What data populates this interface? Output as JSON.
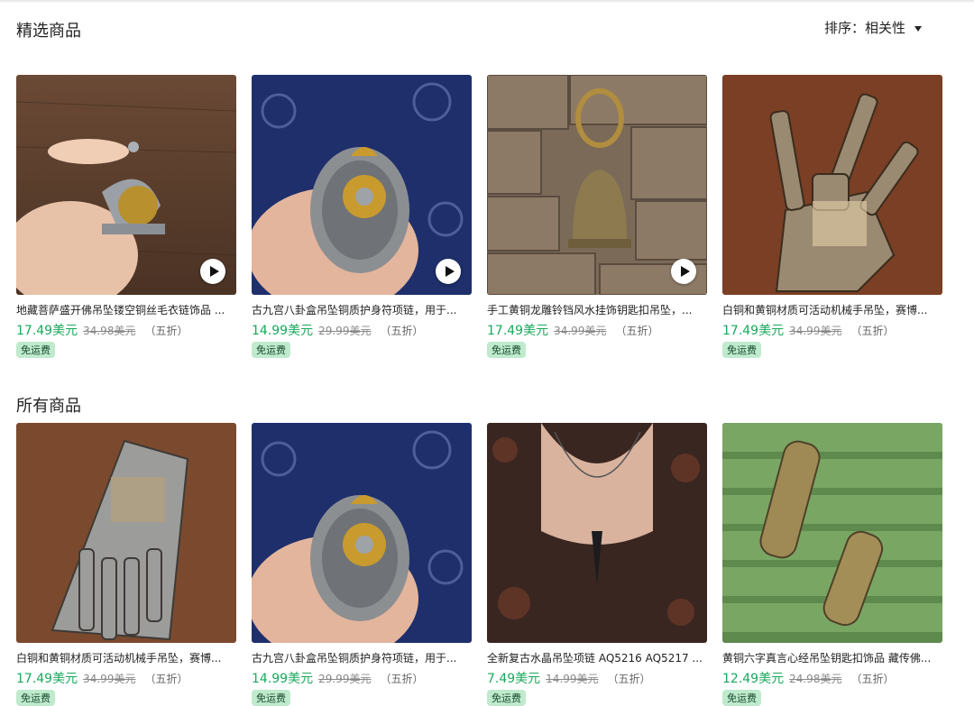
{
  "featured": {
    "title": "精选商品",
    "sort_label": "排序：相关性",
    "products": [
      {
        "title": "地藏菩萨盛开佛吊坠镂空铜丝毛衣链饰品 ...",
        "price": "17.49美元",
        "original_price": "34.98美元",
        "discount": "（五折）",
        "badge": "免运费",
        "icon": "play-icon"
      },
      {
        "title": "古九宫八卦盒吊坠铜质护身符项链，用于...",
        "price": "14.99美元",
        "original_price": "29.99美元",
        "discount": "（五折）",
        "badge": "免运费",
        "icon": "play-icon"
      },
      {
        "title": "手工黄铜龙雕铃铛风水挂饰钥匙扣吊坠，...",
        "price": "17.49美元",
        "original_price": "34.99美元",
        "discount": "（五折）",
        "badge": "免运费",
        "icon": "play-icon"
      },
      {
        "title": "白铜和黄铜材质可活动机械手吊坠，赛博...",
        "price": "17.49美元",
        "original_price": "34.99美元",
        "discount": "（五折）",
        "badge": "免运费"
      }
    ]
  },
  "all": {
    "title": "所有商品",
    "products": [
      {
        "title": "白铜和黄铜材质可活动机械手吊坠，赛博...",
        "price": "17.49美元",
        "original_price": "34.99美元",
        "discount": "（五折）",
        "badge": "免运费"
      },
      {
        "title": "古九宫八卦盒吊坠铜质护身符项链，用于...",
        "price": "14.99美元",
        "original_price": "29.99美元",
        "discount": "（五折）",
        "badge": "免运费"
      },
      {
        "title": "全新复古水晶吊坠项链 AQ5216 AQ5217 ...",
        "price": "7.49美元",
        "original_price": "14.99美元",
        "discount": "（五折）",
        "badge": "免运费"
      },
      {
        "title": "黄铜六字真言心经吊坠钥匙扣饰品 藏传佛...",
        "price": "12.49美元",
        "original_price": "24.98美元",
        "discount": "（五折）",
        "badge": "免运费"
      }
    ]
  },
  "colors": {
    "price": "#1aa85c",
    "badge_bg": "#bfeacd",
    "badge_text": "#174a2c"
  }
}
